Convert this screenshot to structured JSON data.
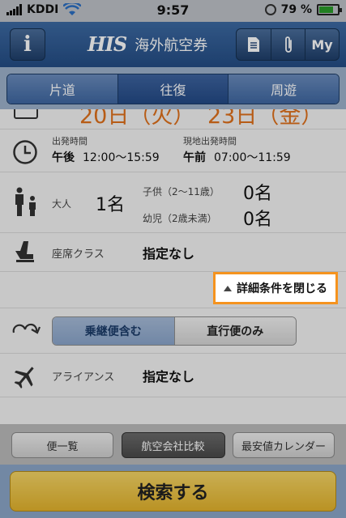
{
  "status_bar": {
    "carrier": "KDDI",
    "time": "9:57",
    "battery": "79 %",
    "battery_level": 0.79
  },
  "header": {
    "info_label": "i",
    "brand_logo": "HIS",
    "title": "海外航空券",
    "my_label": "My"
  },
  "trip_tabs": [
    {
      "label": "片道",
      "selected": false
    },
    {
      "label": "往復",
      "selected": true
    },
    {
      "label": "周遊",
      "selected": false
    }
  ],
  "dates": {
    "depart": "20日（火）",
    "return": "23日（金）",
    "accent_color": "#e0711c"
  },
  "times": {
    "depart_label": "出発時間",
    "depart_period": "午後",
    "depart_value": "12:00〜15:59",
    "local_label": "現地出発時間",
    "local_period": "午前",
    "local_value": "07:00〜11:59"
  },
  "passengers": {
    "adult_label": "大人",
    "adult_count": "1名",
    "child_label": "子供（2〜11歳）",
    "child_count": "0名",
    "infant_label": "幼児（2歳未満）",
    "infant_count": "0名"
  },
  "seat_class": {
    "label": "座席クラス",
    "value": "指定なし"
  },
  "detail_toggle": {
    "label": "詳細条件を閉じる",
    "highlight_color": "#f5931e"
  },
  "connection": {
    "options": [
      "乗継便含む",
      "直行便のみ"
    ],
    "selected_index": 0
  },
  "alliance": {
    "label": "アライアンス",
    "value": "指定なし"
  },
  "bottom_tabs": [
    {
      "label": "便一覧",
      "selected": false
    },
    {
      "label": "航空会社比較",
      "selected": true
    },
    {
      "label": "最安値カレンダー",
      "selected": false
    }
  ],
  "search_button": {
    "label": "検索する"
  }
}
